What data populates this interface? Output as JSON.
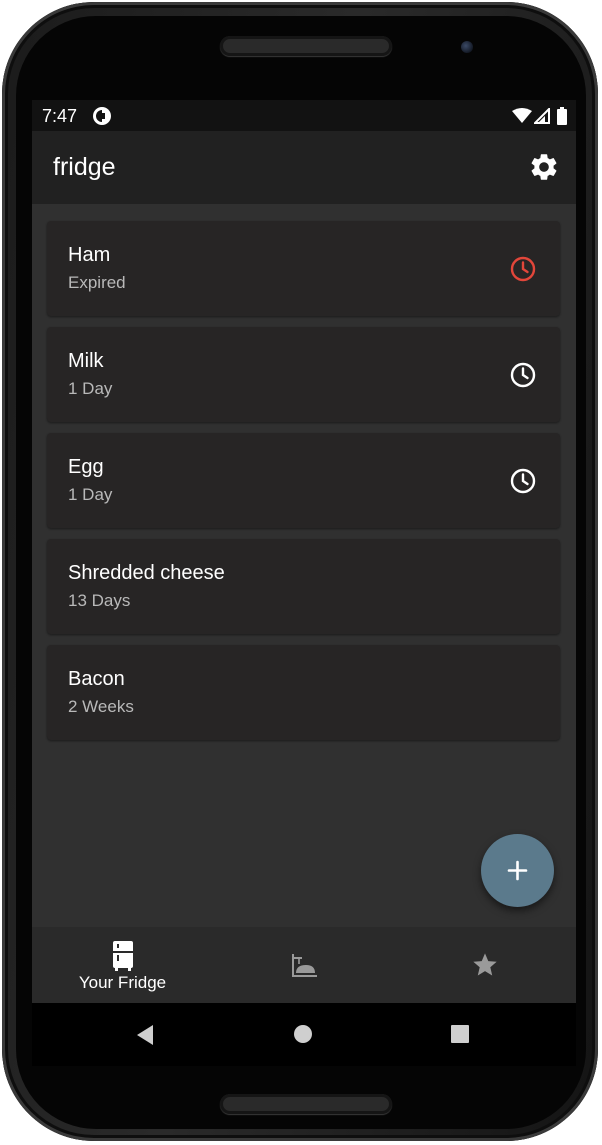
{
  "status_bar": {
    "time": "7:47"
  },
  "app_bar": {
    "title": "fridge"
  },
  "items": [
    {
      "name": "Ham",
      "expiry": "Expired",
      "indicator": "alarm-icon",
      "indicator_color": "#e2463a"
    },
    {
      "name": "Milk",
      "expiry": "1 Day",
      "indicator": "alarm-icon",
      "indicator_color": "#ffffff"
    },
    {
      "name": "Egg",
      "expiry": "1 Day",
      "indicator": "alarm-icon",
      "indicator_color": "#ffffff"
    },
    {
      "name": "Shredded cheese",
      "expiry": "13 Days",
      "indicator": null
    },
    {
      "name": "Bacon",
      "expiry": "2 Weeks",
      "indicator": null
    }
  ],
  "fab": {
    "icon": "plus-icon",
    "color": "#5b7a8c"
  },
  "bottom_nav": {
    "items": [
      {
        "label": "Your Fridge",
        "icon": "fridge-icon",
        "selected": true
      },
      {
        "icon": "cooking-icon",
        "selected": false
      },
      {
        "icon": "star-icon",
        "selected": false
      }
    ]
  },
  "colors": {
    "background": "#303030",
    "app_bar": "#212121",
    "card": "#272525",
    "expired": "#e2463a"
  }
}
